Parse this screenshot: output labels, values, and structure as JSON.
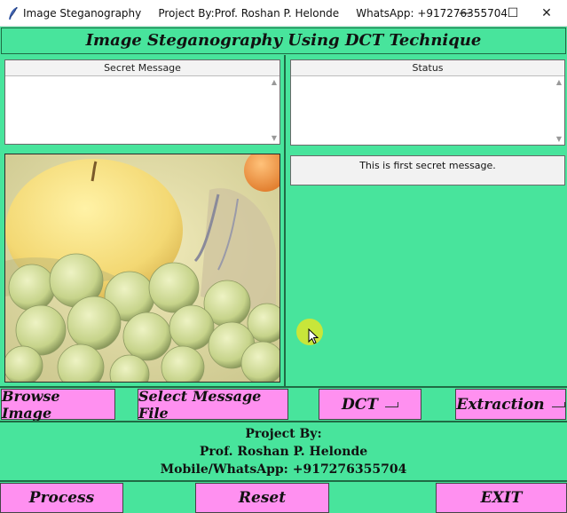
{
  "window": {
    "title": "Image Steganography     Project By:Prof. Roshan P. Helonde     WhatsApp: +917276355704",
    "minimize": "—",
    "maximize": "☐",
    "close": "✕"
  },
  "heading": "Image Steganography Using DCT Technique",
  "secret_panel": {
    "header": "Secret Message",
    "value": ""
  },
  "status_panel": {
    "header": "Status",
    "value": ""
  },
  "message_label": "This is first secret message.",
  "image": {
    "description": "apple-and-grapes-photo"
  },
  "controls": {
    "browse": "Browse Image",
    "select_msg": "Select Message File",
    "method": "DCT",
    "mode": "Extraction"
  },
  "footer": {
    "line1": "Project By:",
    "line2": "Prof. Roshan P. Helonde",
    "line3": "Mobile/WhatsApp: +917276355704"
  },
  "actions": {
    "process": "Process",
    "reset": "Reset",
    "exit": "EXIT"
  },
  "colors": {
    "background": "#48e49c",
    "button": "#ff90f0",
    "cursor": "#c8e63a"
  }
}
